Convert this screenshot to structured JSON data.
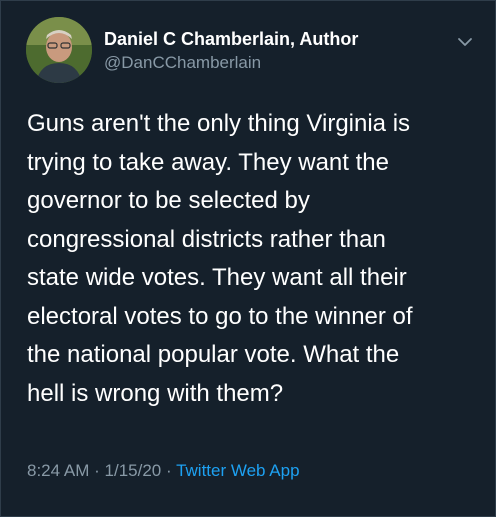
{
  "author": {
    "display_name": "Daniel C Chamberlain, Author",
    "handle": "@DanCChamberlain"
  },
  "tweet": {
    "lines": [
      "Guns aren't the only thing Virginia is",
      "trying to take away. They want the",
      "governor to be selected by",
      "congressional districts rather than",
      "state wide votes. They want all their",
      "electoral votes to go to the winner of",
      "the national popular vote. What the",
      "hell is wrong with them?"
    ]
  },
  "meta": {
    "time": "8:24 AM",
    "separator": "·",
    "date": "1/15/20",
    "source": "Twitter Web App"
  },
  "icons": {
    "caret": "chevron-down-icon"
  },
  "colors": {
    "background": "#15202b",
    "secondary_text": "#8899a6",
    "link": "#1da1f2"
  }
}
